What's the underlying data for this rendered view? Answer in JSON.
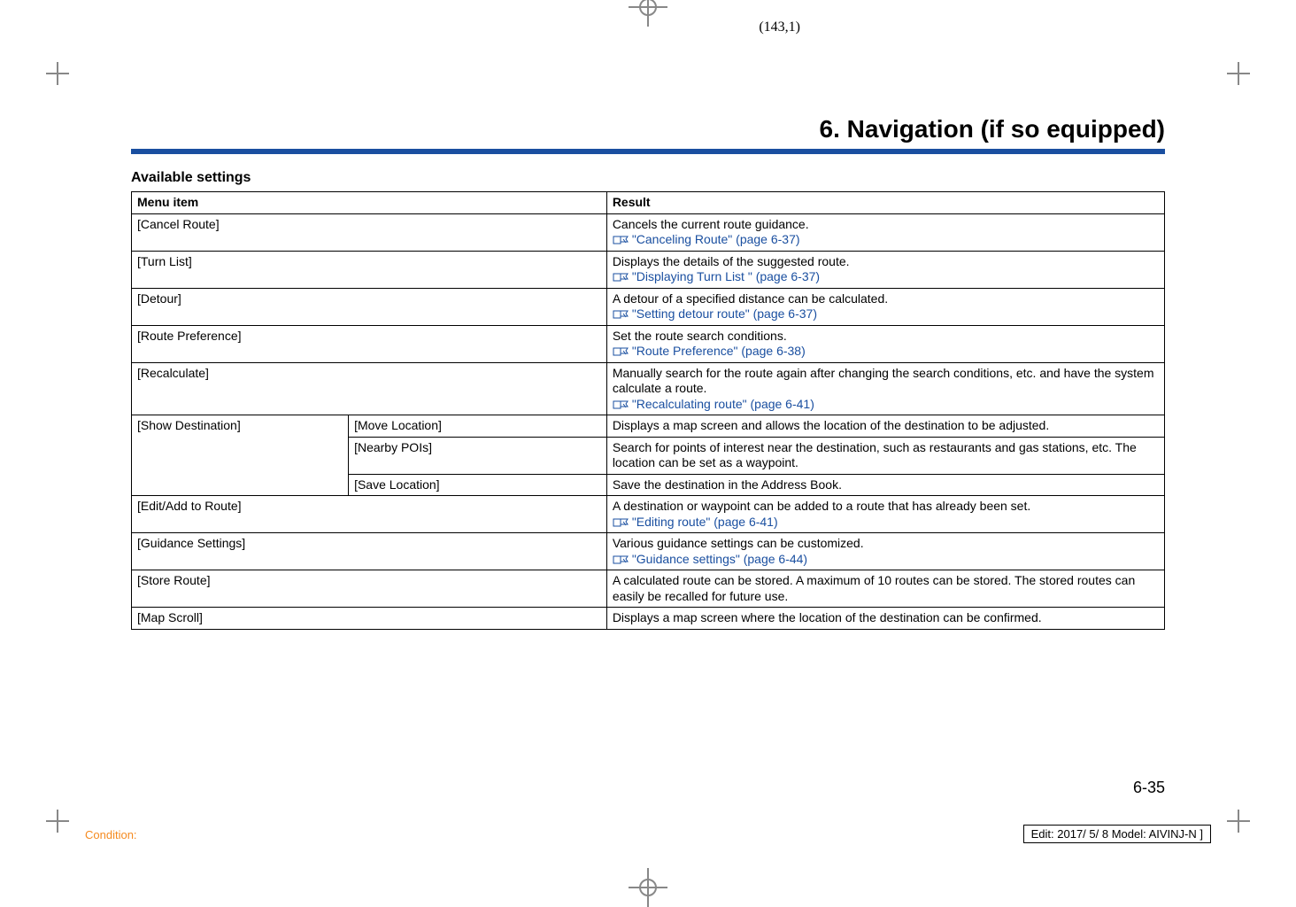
{
  "page_coord": "(143,1)",
  "chapter_title": "6. Navigation (if so equipped)",
  "subheading": "Available settings",
  "headers": {
    "menu": "Menu item",
    "result": "Result"
  },
  "rows": {
    "r1": {
      "menu": "[Cancel Route]",
      "desc": "Cancels the current route guidance.",
      "ref": "\"Canceling Route\" (page 6-37)"
    },
    "r2": {
      "menu": "[Turn List]",
      "desc": "Displays the details of the suggested route.",
      "ref": "\"Displaying Turn List \" (page 6-37)"
    },
    "r3": {
      "menu": "[Detour]",
      "desc": "A detour of a specified distance can be calculated.",
      "ref": "\"Setting detour route\" (page 6-37)"
    },
    "r4": {
      "menu": "[Route Preference]",
      "desc": "Set the route search conditions.",
      "ref": "\"Route Preference\" (page 6-38)"
    },
    "r5": {
      "menu": "[Recalculate]",
      "desc": "Manually search for the route again after changing the search conditions, etc. and have the system calculate a route.",
      "ref": "\"Recalculating route\" (page 6-41)"
    },
    "r6": {
      "menu": "[Show Destination]",
      "sub1": "[Move Location]",
      "sub1_desc": "Displays a map screen and allows the location of the destination to be adjusted.",
      "sub2": "[Nearby POIs]",
      "sub2_desc": "Search for points of interest near the destination, such as restaurants and gas stations, etc. The location can be set as a waypoint.",
      "sub3": "[Save Location]",
      "sub3_desc": "Save the destination in the Address Book."
    },
    "r7": {
      "menu": "[Edit/Add to Route]",
      "desc": "A destination or waypoint can be added to a route that has already been set.",
      "ref": "\"Editing route\" (page 6-41)"
    },
    "r8": {
      "menu": "[Guidance Settings]",
      "desc": "Various guidance settings can be customized.",
      "ref": "\"Guidance settings\" (page 6-44)"
    },
    "r9": {
      "menu": "[Store Route]",
      "desc": "A calculated route can be stored. A maximum of 10 routes can be stored. The stored routes can easily be recalled for future use."
    },
    "r10": {
      "menu": "[Map Scroll]",
      "desc": "Displays a map screen where the location of the destination can be confirmed."
    }
  },
  "page_number": "6-35",
  "footer_left": "Condition:",
  "footer_right": "Edit: 2017/ 5/ 8   Model:  AIVINJ-N ]",
  "ref_icon_svg": "book-hand-icon"
}
